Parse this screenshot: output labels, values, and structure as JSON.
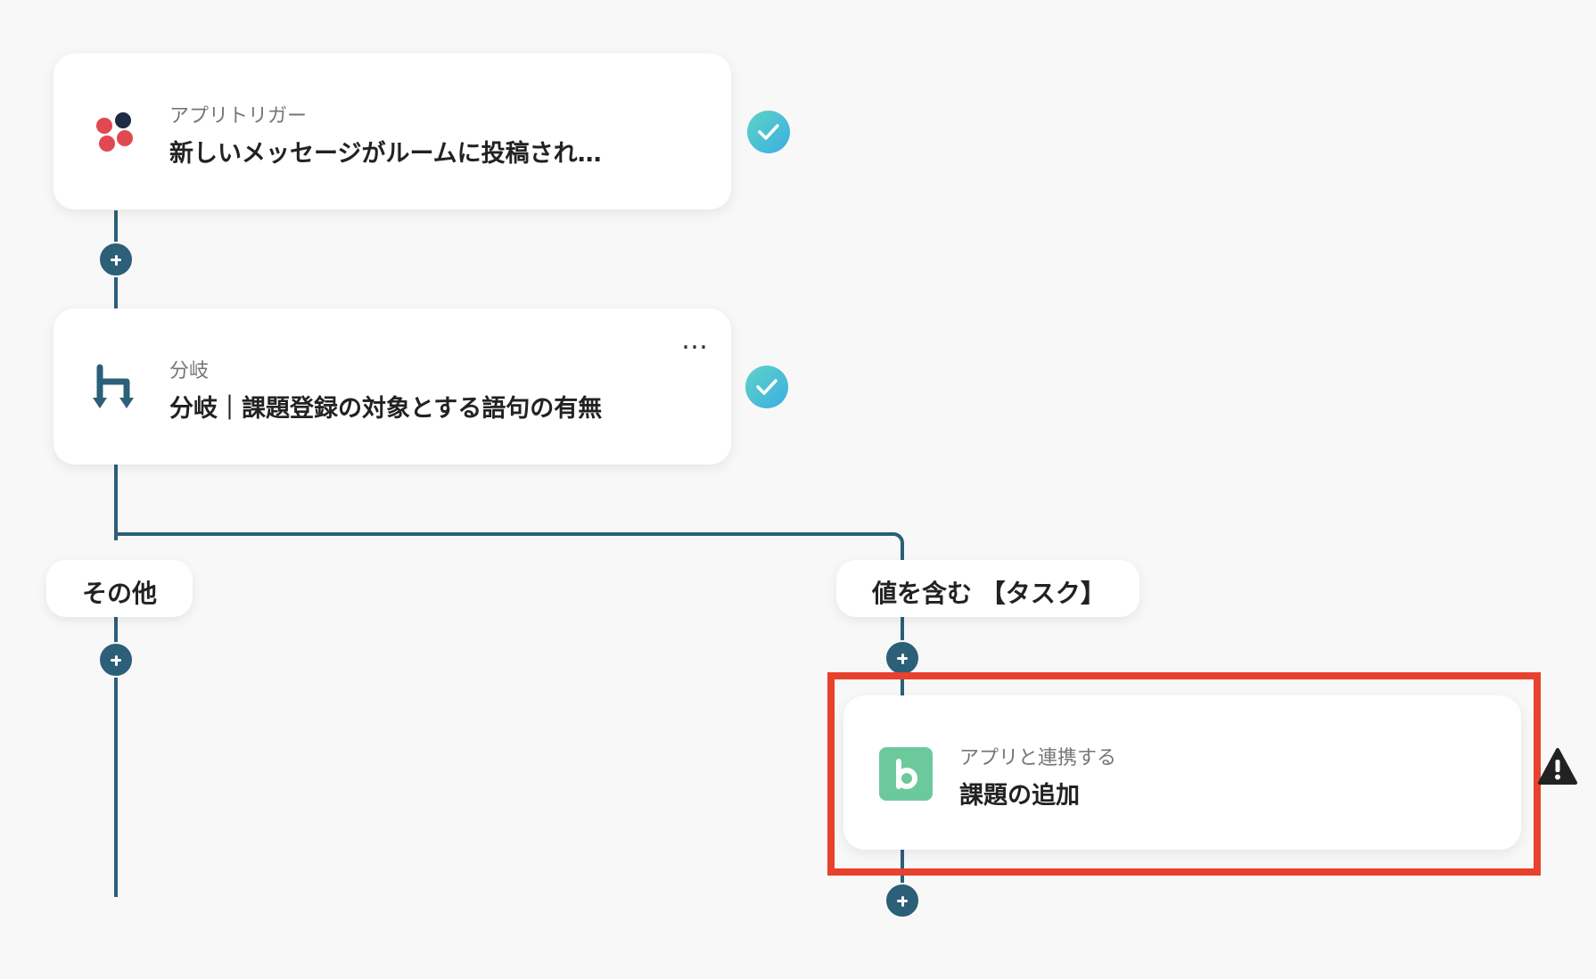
{
  "colors": {
    "background": "#f8f8f8",
    "connector": "#2c5f78",
    "check_start": "#5fd3c6",
    "check_end": "#3aaee3",
    "highlight": "#e8412e",
    "backlog_green": "#6cc99c",
    "chatwork_red": "#e04950",
    "chatwork_dark": "#1f2a44"
  },
  "flow": {
    "trigger": {
      "subtitle": "アプリトリガー",
      "title": "新しいメッセージがルームに投稿され…",
      "icon": "chatwork-logo-icon",
      "status": "complete"
    },
    "branch": {
      "subtitle": "分岐",
      "title": "分岐｜課題登録の対象とする語句の有無",
      "icon": "branch-icon",
      "menu": "…",
      "status": "complete"
    },
    "branches": {
      "else_label": "その他",
      "match_label": "値を含む 【タスク】"
    },
    "action": {
      "subtitle": "アプリと連携する",
      "title": "課題の追加",
      "icon": "backlog-logo-icon",
      "status": "warning",
      "highlighted": true
    }
  }
}
